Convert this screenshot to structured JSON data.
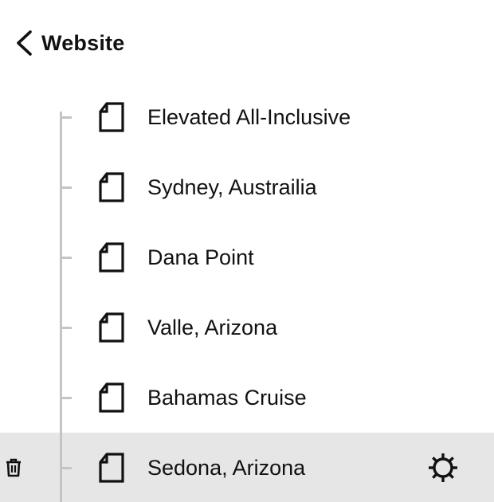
{
  "header": {
    "back_label": "Website",
    "back_icon": "chevron-left-icon"
  },
  "pages": [
    {
      "label": "Elevated All-Inclusive",
      "icon": "page-icon",
      "selected": false
    },
    {
      "label": "Sydney, Austrailia",
      "icon": "page-icon",
      "selected": false
    },
    {
      "label": "Dana Point",
      "icon": "page-icon",
      "selected": false
    },
    {
      "label": "Valle, Arizona",
      "icon": "page-icon",
      "selected": false
    },
    {
      "label": "Bahamas Cruise",
      "icon": "page-icon",
      "selected": false
    },
    {
      "label": "Sedona, Arizona",
      "icon": "page-icon",
      "selected": true
    }
  ],
  "selected_row_actions": {
    "delete_icon": "trash-icon",
    "settings_icon": "gear-icon"
  },
  "colors": {
    "selected_row_bg": "#e6e6e6",
    "tree_line": "#c4c4c4",
    "text": "#111111"
  }
}
